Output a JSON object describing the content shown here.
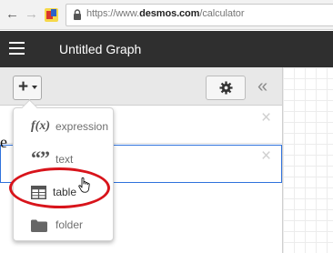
{
  "browser": {
    "url_prefix": "https://www.",
    "url_domain": "desmos.com",
    "url_path": "/calculator",
    "back_glyph": "←",
    "forward_glyph": "→"
  },
  "header": {
    "title": "Untitled Graph",
    "menu_icon": "hamburger-icon"
  },
  "toolbar": {
    "add_glyph": "+",
    "settings_icon": "gear-icon",
    "collapse_glyph": "«"
  },
  "expressions": {
    "close_glyph": "×"
  },
  "page_edge_letter": "e",
  "add_menu": {
    "items": [
      {
        "icon_text": "f(x)",
        "label": "expression"
      },
      {
        "icon_text": "“”",
        "label": "text"
      },
      {
        "icon": "table-icon",
        "label": "table"
      },
      {
        "icon": "folder-icon",
        "label": "folder"
      }
    ]
  },
  "colors": {
    "header_bg": "#2f2f2f",
    "highlight": "#d8141b",
    "focus_border": "#2f72dc"
  }
}
